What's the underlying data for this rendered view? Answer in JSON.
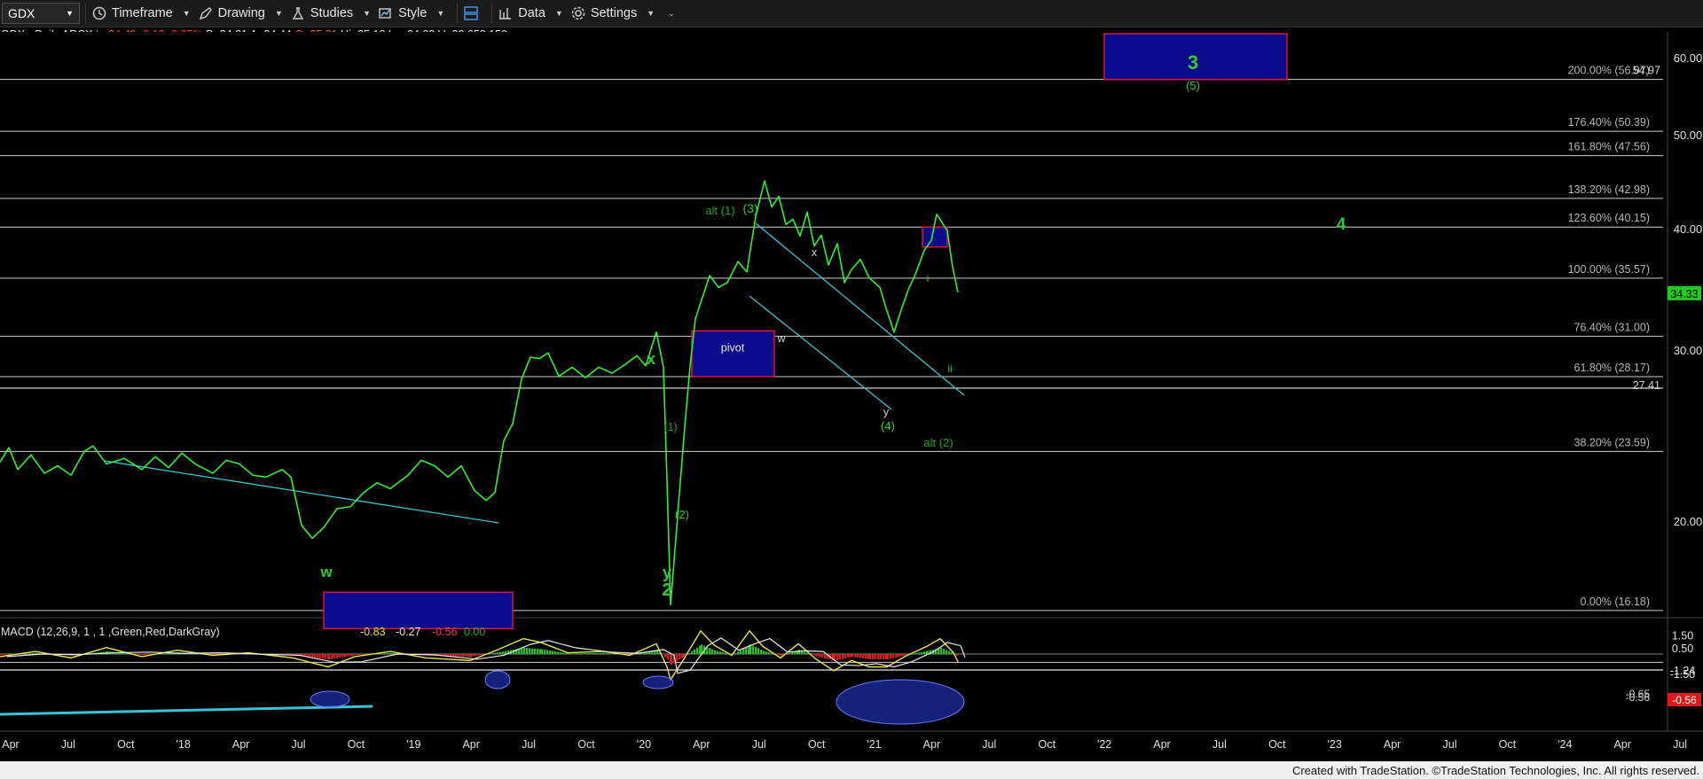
{
  "toolbar": {
    "symbol": "GDX",
    "timeframe": "Timeframe",
    "drawing": "Drawing",
    "studies": "Studies",
    "style": "Style",
    "data": "Data",
    "settings": "Settings"
  },
  "quote": {
    "name": "GDX - Daily  ARCX",
    "last": "L=34.43",
    "chg": "-0.12",
    "pct": "-0.35%",
    "bid": "B=34.31",
    "ask": "A=34.44",
    "open": "O=35.01",
    "hi": "Hi=35.18",
    "lo": "Lo=34.33",
    "vol": "V=22,658,159"
  },
  "colors": {
    "price": "#33ee33",
    "fib": "#cfcfcf",
    "box_fill": "#0a0a8a",
    "box_border": "#e8173a",
    "trend": "#3ac3d6",
    "label_green": "#2ecc2e",
    "label_dark": "#23a023"
  },
  "chart_data": {
    "type": "line",
    "price_axis": {
      "min": 12.5,
      "max": 63,
      "scale": "log",
      "ticks": [
        20,
        30,
        40,
        50,
        60
      ]
    },
    "x_ticks": [
      "Apr",
      "Jul",
      "Oct",
      "'18",
      "Apr",
      "Jul",
      "Oct",
      "'19",
      "Apr",
      "Jul",
      "Oct",
      "'20",
      "Apr",
      "Jul",
      "Oct",
      "'21",
      "Apr",
      "Jul",
      "Oct",
      "'22",
      "Apr",
      "Jul",
      "Oct",
      "'23",
      "Apr",
      "Jul",
      "Oct",
      "'24",
      "Apr",
      "Jul"
    ],
    "series": [
      {
        "points": [
          [
            0,
            23.0
          ],
          [
            10,
            23.8
          ],
          [
            20,
            22.6
          ],
          [
            35,
            23.4
          ],
          [
            50,
            22.4
          ],
          [
            65,
            22.8
          ],
          [
            80,
            22.3
          ],
          [
            95,
            23.6
          ],
          [
            105,
            23.9
          ],
          [
            120,
            22.9
          ],
          [
            140,
            23.2
          ],
          [
            160,
            22.6
          ],
          [
            175,
            23.3
          ],
          [
            190,
            22.7
          ],
          [
            205,
            23.5
          ],
          [
            220,
            22.9
          ],
          [
            240,
            22.4
          ],
          [
            255,
            23.1
          ],
          [
            270,
            22.9
          ],
          [
            285,
            22.3
          ],
          [
            300,
            22.2
          ],
          [
            318,
            22.6
          ],
          [
            328,
            22.2
          ],
          [
            340,
            19.8
          ],
          [
            352,
            19.2
          ],
          [
            365,
            19.7
          ],
          [
            380,
            20.6
          ],
          [
            395,
            20.7
          ],
          [
            410,
            21.4
          ],
          [
            425,
            21.9
          ],
          [
            440,
            21.6
          ],
          [
            460,
            22.3
          ],
          [
            475,
            23.1
          ],
          [
            490,
            22.8
          ],
          [
            505,
            22.2
          ],
          [
            520,
            22.8
          ],
          [
            535,
            21.5
          ],
          [
            548,
            21.0
          ],
          [
            558,
            21.4
          ],
          [
            568,
            24.2
          ],
          [
            578,
            25.2
          ],
          [
            588,
            28.0
          ],
          [
            598,
            29.5
          ],
          [
            608,
            29.4
          ],
          [
            618,
            29.8
          ],
          [
            630,
            28.2
          ],
          [
            645,
            28.8
          ],
          [
            660,
            28.1
          ],
          [
            675,
            28.8
          ],
          [
            690,
            28.4
          ],
          [
            705,
            29.0
          ],
          [
            718,
            29.6
          ],
          [
            728,
            28.9
          ],
          [
            740,
            31.3
          ],
          [
            748,
            28.8
          ],
          [
            752,
            22.0
          ],
          [
            756,
            16.4
          ],
          [
            760,
            18.2
          ],
          [
            766,
            21.4
          ],
          [
            772,
            25.0
          ],
          [
            778,
            28.9
          ],
          [
            784,
            32.3
          ],
          [
            792,
            34.0
          ],
          [
            800,
            35.8
          ],
          [
            810,
            34.8
          ],
          [
            820,
            35.2
          ],
          [
            832,
            37.0
          ],
          [
            842,
            36.1
          ],
          [
            852,
            41.2
          ],
          [
            862,
            44.8
          ],
          [
            870,
            42.1
          ],
          [
            878,
            43.2
          ],
          [
            886,
            40.4
          ],
          [
            894,
            40.9
          ],
          [
            902,
            39.3
          ],
          [
            910,
            41.6
          ],
          [
            918,
            38.4
          ],
          [
            926,
            39.4
          ],
          [
            934,
            36.7
          ],
          [
            944,
            38.6
          ],
          [
            952,
            35.2
          ],
          [
            960,
            36.3
          ],
          [
            970,
            37.2
          ],
          [
            980,
            35.6
          ],
          [
            992,
            34.8
          ],
          [
            1000,
            32.9
          ],
          [
            1008,
            31.3
          ],
          [
            1016,
            33.0
          ],
          [
            1024,
            34.6
          ],
          [
            1032,
            35.9
          ],
          [
            1042,
            38.0
          ],
          [
            1050,
            38.9
          ],
          [
            1056,
            41.4
          ],
          [
            1062,
            40.6
          ],
          [
            1068,
            39.8
          ],
          [
            1074,
            36.5
          ],
          [
            1080,
            34.4
          ]
        ]
      },
      {
        "name": "MACD",
        "points": [
          [
            0,
            -0.2
          ],
          [
            40,
            0.2
          ],
          [
            80,
            -0.3
          ],
          [
            120,
            0.5
          ],
          [
            160,
            -0.2
          ],
          [
            200,
            0.3
          ],
          [
            240,
            -0.1
          ],
          [
            280,
            0.1
          ],
          [
            330,
            -0.3
          ],
          [
            370,
            -1.0
          ],
          [
            400,
            -0.2
          ],
          [
            440,
            0.2
          ],
          [
            480,
            -0.3
          ],
          [
            530,
            -0.5
          ],
          [
            560,
            0.3
          ],
          [
            590,
            1.2
          ],
          [
            610,
            0.9
          ],
          [
            640,
            0.1
          ],
          [
            680,
            0.2
          ],
          [
            710,
            -0.1
          ],
          [
            740,
            0.8
          ],
          [
            752,
            -1.0
          ],
          [
            756,
            -2.0
          ],
          [
            770,
            -0.5
          ],
          [
            790,
            1.8
          ],
          [
            805,
            0.7
          ],
          [
            825,
            -0.1
          ],
          [
            845,
            1.8
          ],
          [
            860,
            0.6
          ],
          [
            880,
            -0.3
          ],
          [
            900,
            0.8
          ],
          [
            920,
            -0.4
          ],
          [
            940,
            -1.3
          ],
          [
            960,
            -0.5
          ],
          [
            980,
            -1.0
          ],
          [
            1000,
            -1.0
          ],
          [
            1020,
            -0.2
          ],
          [
            1045,
            0.6
          ],
          [
            1060,
            1.2
          ],
          [
            1075,
            0.1
          ],
          [
            1080,
            -0.6
          ]
        ]
      }
    ],
    "macd_axis": {
      "min": -1.8,
      "max": 2.2,
      "ticks": [
        1.5,
        0.5,
        -1.24,
        -1.5
      ]
    },
    "fib_levels": [
      {
        "label": "200.00% (56.97)",
        "price": 56.97
      },
      {
        "label": "176.40% (50.39)",
        "price": 50.39
      },
      {
        "label": "161.80% (47.56)",
        "price": 47.56
      },
      {
        "label": "138.20% (42.98)",
        "price": 42.98
      },
      {
        "label": "123.60% (40.15)",
        "price": 40.15
      },
      {
        "label": "100.00% (35.57)",
        "price": 35.57
      },
      {
        "label": "76.40% (31.00)",
        "price": 31.0
      },
      {
        "label": "61.80% (28.17)",
        "price": 28.17
      },
      {
        "label": "38.20% (23.59)",
        "price": 23.59
      },
      {
        "label": "0.00% (16.18)",
        "price": 16.18
      }
    ],
    "extra_level": {
      "label": "27.41",
      "price": 27.41
    },
    "price_overlay_right": "54.97",
    "last_price_label": "34.33",
    "macd_header": "MACD (12,26,9, 1 , 1 ,Green,Red,DarkGray)",
    "macd_values": [
      "-0.83",
      "-0.27",
      "-0.56",
      "0.00"
    ],
    "macd_right_labels": [
      "-0.56",
      "-0.65",
      "-0.56"
    ],
    "wave_labels": [
      {
        "text": "3",
        "size": "big"
      },
      {
        "text": "(5)",
        "size": "small"
      },
      {
        "text": "alt (1)"
      },
      {
        "text": "(3)"
      },
      {
        "text": "x"
      },
      {
        "text": "i"
      },
      {
        "text": "w"
      },
      {
        "text": "y"
      },
      {
        "text": "(4)"
      },
      {
        "text": "ii"
      },
      {
        "text": "alt (2)"
      },
      {
        "text": "x"
      },
      {
        "text": "(1)"
      },
      {
        "text": "(2)"
      },
      {
        "text": "y"
      },
      {
        "text": "2"
      },
      {
        "text": "w"
      },
      {
        "text": "4"
      }
    ],
    "pivot_label": "pivot"
  },
  "footer": "Created with TradeStation. ©TradeStation Technologies, Inc. All rights reserved."
}
